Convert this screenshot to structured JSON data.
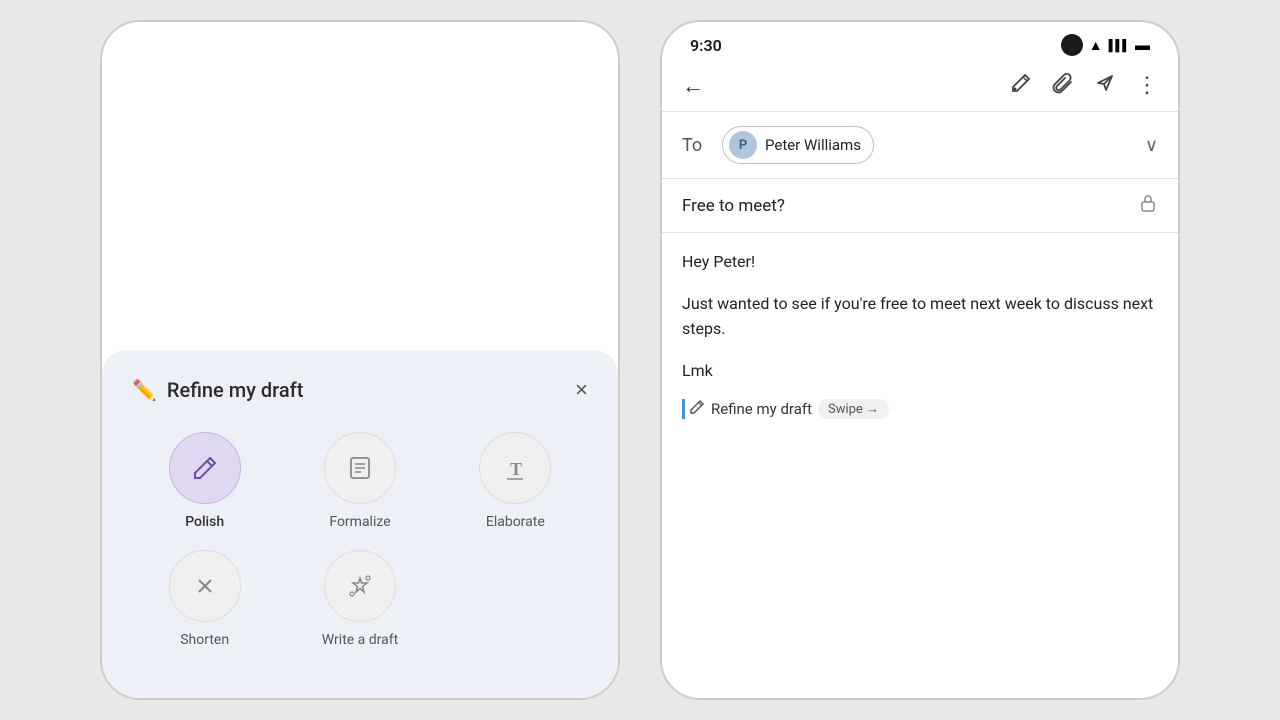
{
  "app": {
    "background_color": "#e8e8e8"
  },
  "left_phone": {
    "refine_panel": {
      "title": "Refine my draft",
      "title_icon": "✏️",
      "close_label": "×",
      "options": [
        {
          "id": "polish",
          "label": "Polish",
          "icon": "✏",
          "active": true
        },
        {
          "id": "formalize",
          "label": "Formalize",
          "icon": "💼",
          "active": false
        },
        {
          "id": "elaborate",
          "label": "Elaborate",
          "icon": "T",
          "active": false
        },
        {
          "id": "shorten",
          "label": "Shorten",
          "icon": "✕",
          "active": false
        },
        {
          "id": "write-draft",
          "label": "Write a draft",
          "icon": "✦",
          "active": false
        }
      ]
    }
  },
  "right_phone": {
    "status_bar": {
      "time": "9:30"
    },
    "toolbar": {
      "back_icon": "←",
      "edit_icon": "✏",
      "attach_icon": "🔗",
      "send_icon": "▷",
      "more_icon": "⋮"
    },
    "to_field": {
      "label": "To",
      "recipient": {
        "initial": "P",
        "name": "Peter Williams"
      },
      "chevron": "∨"
    },
    "subject": {
      "text": "Free to meet?",
      "lock_icon": "🔒"
    },
    "body": {
      "greeting": "Hey Peter!",
      "paragraph": "Just wanted to see if you're free to meet next week to discuss next steps.",
      "signature": "Lmk"
    },
    "refine_suggestion": {
      "icon": "✏",
      "text": "Refine my draft",
      "swipe_label": "Swipe →"
    }
  }
}
